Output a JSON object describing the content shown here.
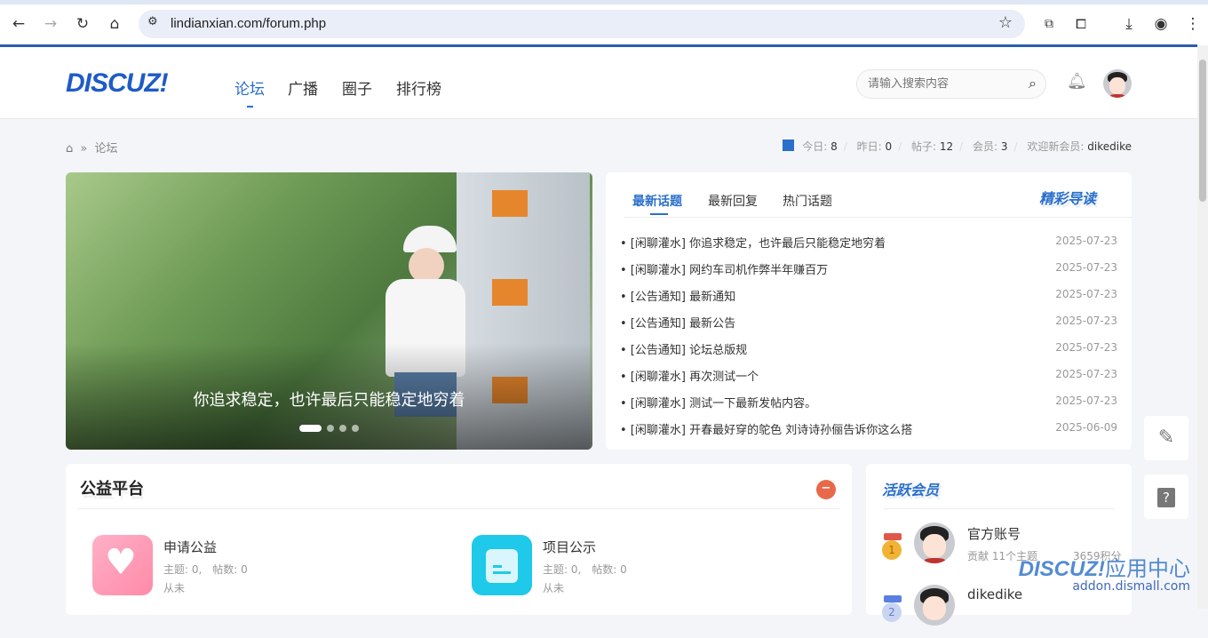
{
  "browser": {
    "url": "lindianxian.com/forum.php"
  },
  "header": {
    "logo": "DISCUZ!",
    "nav": [
      "论坛",
      "广播",
      "圈子",
      "排行榜"
    ],
    "search_placeholder": "请输入搜索内容"
  },
  "breadcrumb": {
    "current": "论坛",
    "sep": "»"
  },
  "stats": {
    "today_label": "今日:",
    "today": "8",
    "yesterday_label": "昨日:",
    "yesterday": "0",
    "posts_label": "帖子:",
    "posts": "12",
    "members_label": "会员:",
    "members": "3",
    "welcome_label": "欢迎新会员:",
    "newest": "dikedike"
  },
  "hero": {
    "caption": "你追求稳定，也许最后只能稳定地穷着",
    "slides": 4,
    "active": 0
  },
  "topics": {
    "tabs": [
      "最新话题",
      "最新回复",
      "热门话题"
    ],
    "title": "精彩导读",
    "items": [
      {
        "title": "[闲聊灌水] 你追求稳定，也许最后只能稳定地穷着",
        "date": "2025-07-23"
      },
      {
        "title": "[闲聊灌水] 网约车司机作弊半年赚百万",
        "date": "2025-07-23"
      },
      {
        "title": "[公告通知] 最新通知",
        "date": "2025-07-23"
      },
      {
        "title": "[公告通知] 最新公告",
        "date": "2025-07-23"
      },
      {
        "title": "[公告通知] 论坛总版规",
        "date": "2025-07-23"
      },
      {
        "title": "[闲聊灌水] 再次测试一个",
        "date": "2025-07-23"
      },
      {
        "title": "[闲聊灌水] 测试一下最新发帖内容。",
        "date": "2025-07-23"
      },
      {
        "title": "[闲聊灌水] 开春最好穿的鸵色 刘诗诗孙俪告诉你这么搭",
        "date": "2025-06-09"
      }
    ]
  },
  "welfare": {
    "title": "公益平台",
    "forums": [
      {
        "name": "申请公益",
        "meta": "主题: 0,　帖数: 0",
        "last": "从未"
      },
      {
        "name": "项目公示",
        "meta": "主题: 0,　帖数: 0",
        "last": "从未"
      }
    ]
  },
  "members": {
    "title": "活跃会员",
    "items": [
      {
        "name": "官方账号",
        "contrib": "贡献 11个主题",
        "points": "3659积分",
        "rank": "1"
      },
      {
        "name": "dikedike",
        "rank": "2"
      }
    ]
  },
  "watermark": {
    "brand": "DISCUZ!应用中心",
    "site": "addon.dismall.com"
  },
  "colors": {
    "accent": "#2a6fcb",
    "minus": "#e8694a"
  }
}
